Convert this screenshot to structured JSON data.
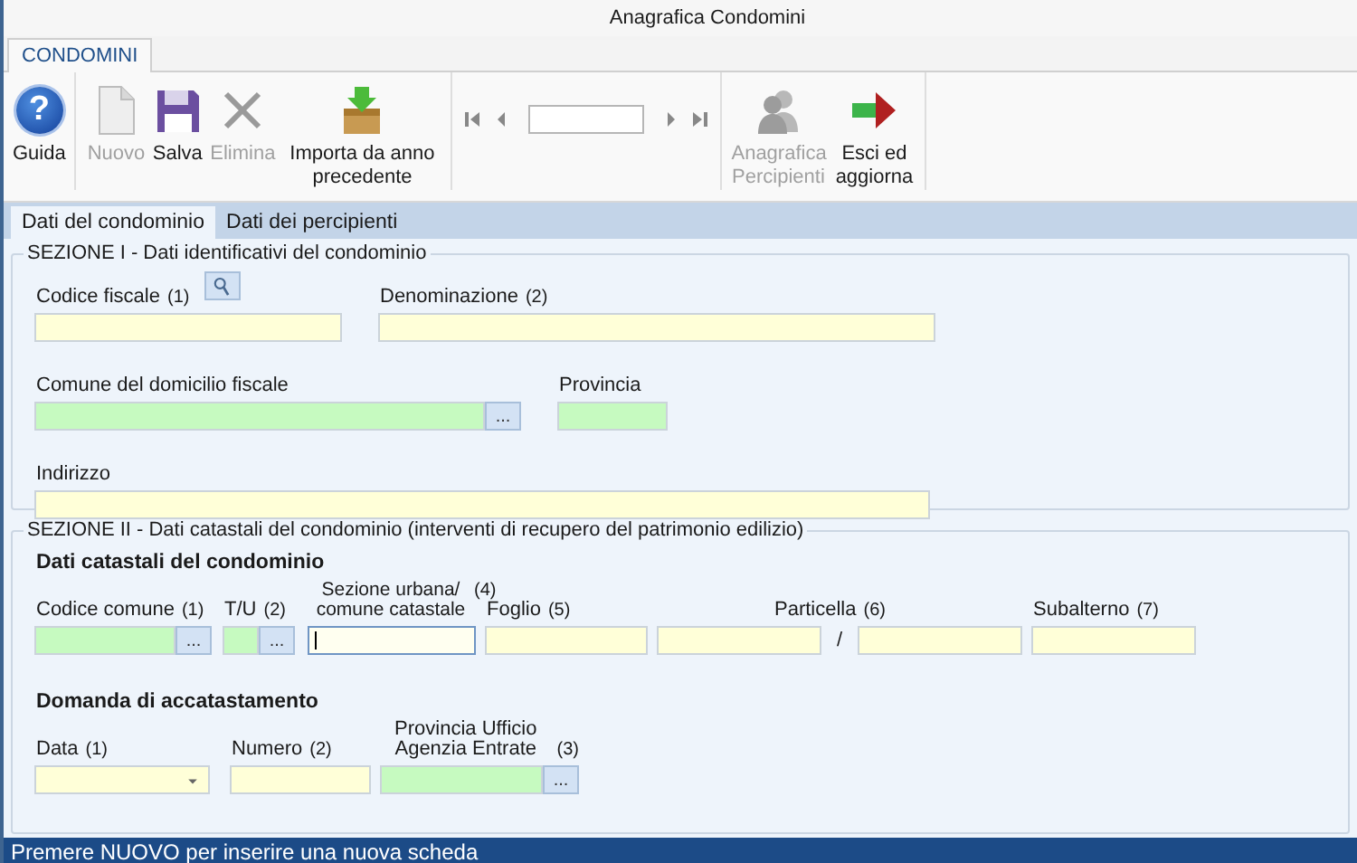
{
  "window": {
    "title": "Anagrafica Condomini"
  },
  "ribbon_tabs": [
    {
      "label": "CONDOMINI",
      "selected": true
    }
  ],
  "toolbar": {
    "groups": [
      {
        "kind": "buttons",
        "buttons": [
          {
            "kind": "help",
            "glyph": "?",
            "label": "Guida",
            "disabled": false
          }
        ]
      },
      {
        "kind": "buttons",
        "buttons": [
          {
            "kind": "new",
            "label": "Nuovo",
            "disabled": true
          },
          {
            "kind": "save",
            "label": "Salva",
            "disabled": false
          },
          {
            "kind": "delete",
            "label": "Elimina",
            "disabled": true
          },
          {
            "kind": "import",
            "label": "Importa da anno precedente",
            "disabled": false
          }
        ]
      },
      {
        "kind": "navigator"
      },
      {
        "kind": "buttons",
        "buttons": [
          {
            "kind": "people",
            "label": "Anagrafica Percipienti",
            "disabled": true
          },
          {
            "kind": "exit",
            "label": "Esci ed aggiorna",
            "disabled": false
          }
        ]
      }
    ]
  },
  "tabs": [
    {
      "label": "Dati del condominio",
      "selected": true
    },
    {
      "label": "Dati dei percipienti",
      "selected": false
    }
  ],
  "section_1": {
    "title": "SEZIONE I - Dati identificativi del condominio",
    "fields": [
      {
        "label": "Codice fiscale",
        "note": "(1)",
        "kind": "text",
        "search_button": true,
        "focused": false
      },
      {
        "label": "Denominazione",
        "note": "(2)",
        "kind": "text",
        "focused": false
      },
      {
        "label": "Comune del domicilio fiscale",
        "kind": "lookup",
        "button": "...",
        "focused": false
      },
      {
        "label": "Provincia",
        "kind": "readonly",
        "focused": false
      },
      {
        "label": "Indirizzo",
        "kind": "text",
        "focused": false
      }
    ]
  },
  "section_2": {
    "title": "SEZIONE II - Dati catastali del condominio (interventi di recupero del patrimonio edilizio)",
    "groups": [
      {
        "heading": "Dati catastali del condominio",
        "fields": [
          {
            "label": "Codice comune",
            "note": "(1)",
            "kind": "lookup",
            "button": "...",
            "focused": false
          },
          {
            "label": "T/U",
            "note": "(2)",
            "kind": "lookup",
            "button": "...",
            "focused": false
          },
          {
            "label": "Sezione urbana/ comune catastale",
            "note": "(4)",
            "kind": "text",
            "focused": true
          },
          {
            "label": "Foglio",
            "note": "(5)",
            "kind": "text",
            "focused": false
          },
          {
            "label": "Particella",
            "note": "(6)",
            "kind": "split",
            "separator": "/",
            "focused": false
          },
          {
            "label": "Subalterno",
            "note": "(7)",
            "kind": "text",
            "focused": false
          }
        ]
      },
      {
        "heading": "Domanda di accatastamento",
        "fields": [
          {
            "label": "Data",
            "note": "(1)",
            "kind": "date",
            "focused": false
          },
          {
            "label": "Numero",
            "note": "(2)",
            "kind": "text",
            "focused": false
          },
          {
            "label": "Provincia Ufficio Agenzia Entrate",
            "note": "(3)",
            "kind": "lookup",
            "button": "...",
            "focused": false
          }
        ]
      }
    ]
  },
  "status_bar": "Premere NUOVO per inserire una nuova scheda"
}
